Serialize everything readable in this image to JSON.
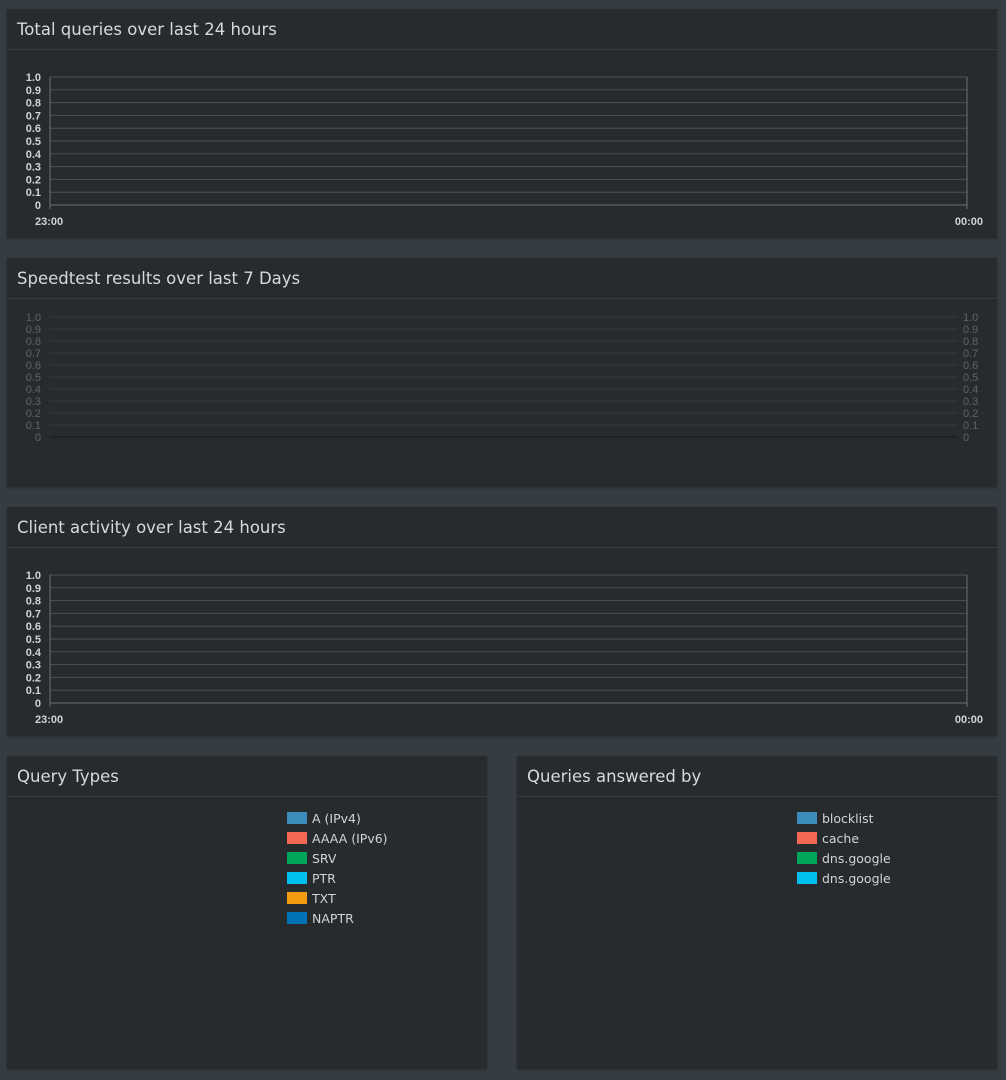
{
  "panels": {
    "total_queries": {
      "title": "Total queries over last 24 hours"
    },
    "speedtest": {
      "title": "Speedtest results over last 7 Days"
    },
    "client_activity": {
      "title": "Client activity over last 24 hours"
    },
    "query_types": {
      "title": "Query Types",
      "legend": [
        {
          "label": "A (IPv4)",
          "color": "#3c8dbc"
        },
        {
          "label": "AAAA (IPv6)",
          "color": "#f56954"
        },
        {
          "label": "SRV",
          "color": "#00a65a"
        },
        {
          "label": "PTR",
          "color": "#00c0ef"
        },
        {
          "label": "TXT",
          "color": "#f39c12"
        },
        {
          "label": "NAPTR",
          "color": "#0073b7"
        }
      ]
    },
    "answered_by": {
      "title": "Queries answered by",
      "legend": [
        {
          "label": "blocklist",
          "color": "#3c8dbc"
        },
        {
          "label": "cache",
          "color": "#f56954"
        },
        {
          "label": "dns.google",
          "color": "#00a65a"
        },
        {
          "label": "dns.google",
          "color": "#00c0ef"
        }
      ]
    }
  },
  "chart_data": [
    {
      "type": "bar",
      "title": "Total queries over last 24 hours",
      "x_ticks": [
        "23:00",
        "00:00"
      ],
      "y_ticks": [
        "1.0",
        "0.9",
        "0.8",
        "0.7",
        "0.6",
        "0.5",
        "0.4",
        "0.3",
        "0.2",
        "0.1",
        "0"
      ],
      "ylim": [
        0,
        1
      ],
      "series": [],
      "grid": true
    },
    {
      "type": "line",
      "title": "Speedtest results over last 7 Days",
      "y_ticks_left": [
        "1.0",
        "0.9",
        "0.8",
        "0.7",
        "0.6",
        "0.5",
        "0.4",
        "0.3",
        "0.2",
        "0.1",
        "0"
      ],
      "y_ticks_right": [
        "1.0",
        "0.9",
        "0.8",
        "0.7",
        "0.6",
        "0.5",
        "0.4",
        "0.3",
        "0.2",
        "0.1",
        "0"
      ],
      "ylim": [
        0,
        1
      ],
      "series": [],
      "grid": true
    },
    {
      "type": "bar",
      "title": "Client activity over last 24 hours",
      "x_ticks": [
        "23:00",
        "00:00"
      ],
      "y_ticks": [
        "1.0",
        "0.9",
        "0.8",
        "0.7",
        "0.6",
        "0.5",
        "0.4",
        "0.3",
        "0.2",
        "0.1",
        "0"
      ],
      "ylim": [
        0,
        1
      ],
      "series": [],
      "grid": true
    }
  ]
}
